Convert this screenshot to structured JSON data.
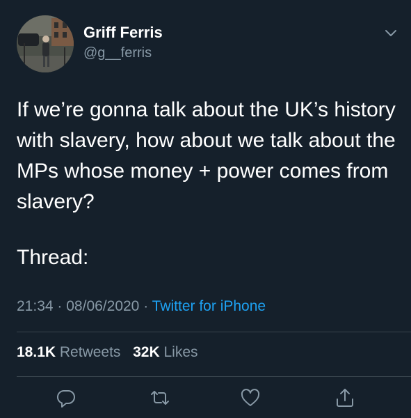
{
  "author": {
    "display_name": "Griff Ferris",
    "handle": "@g__ferris"
  },
  "tweet": {
    "text": "If we’re gonna talk about the UK’s history with slavery, how about we talk about the MPs whose money + power comes from slavery?",
    "thread_label": "Thread:",
    "time": "21:34",
    "date": "08/06/2020",
    "separator": "·",
    "source": "Twitter for iPhone"
  },
  "stats": {
    "retweets_count": "18.1K",
    "retweets_label": "Retweets",
    "likes_count": "32K",
    "likes_label": "Likes"
  },
  "actions": {
    "icons": [
      "reply-icon",
      "retweet-icon",
      "like-icon",
      "share-icon"
    ]
  },
  "colors": {
    "background": "#15202b",
    "primary_text": "#ffffff",
    "secondary_text": "#8899a6",
    "accent": "#1da1f2",
    "divider": "#38444d"
  }
}
